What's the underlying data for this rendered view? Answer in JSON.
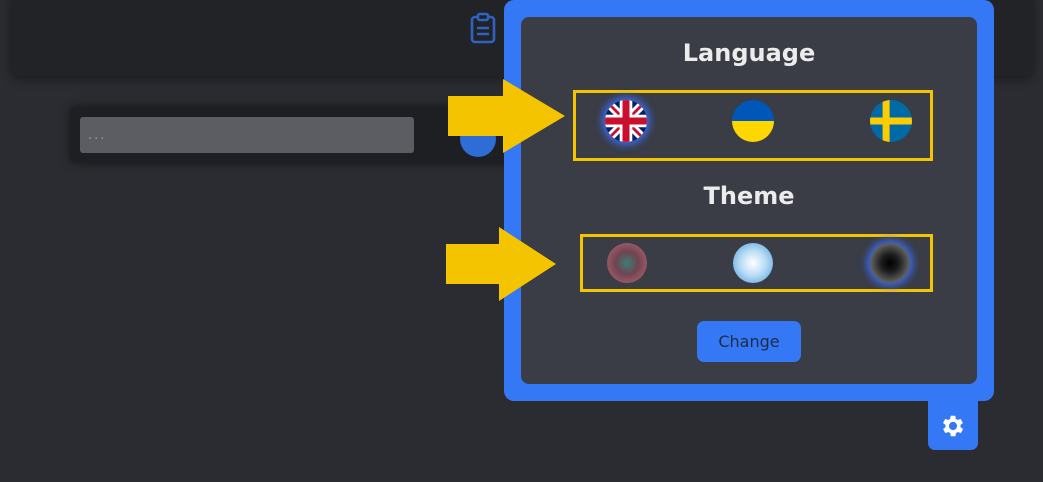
{
  "settings_panel": {
    "language_title": "Language",
    "theme_title": "Theme",
    "change_label": "Change",
    "languages": [
      {
        "name": "english-flag-icon",
        "selected": true
      },
      {
        "name": "ukraine-flag-icon",
        "selected": false
      },
      {
        "name": "sweden-flag-icon",
        "selected": false
      }
    ],
    "themes": [
      {
        "name": "red-theme-icon",
        "selected": false
      },
      {
        "name": "light-theme-icon",
        "selected": false
      },
      {
        "name": "dark-theme-icon",
        "selected": true
      }
    ]
  },
  "task_input": {
    "placeholder": "..."
  },
  "colors": {
    "accent": "#3478f6",
    "highlight": "#f5c400",
    "panel": "#3a3c46",
    "background": "#2b2c31"
  }
}
